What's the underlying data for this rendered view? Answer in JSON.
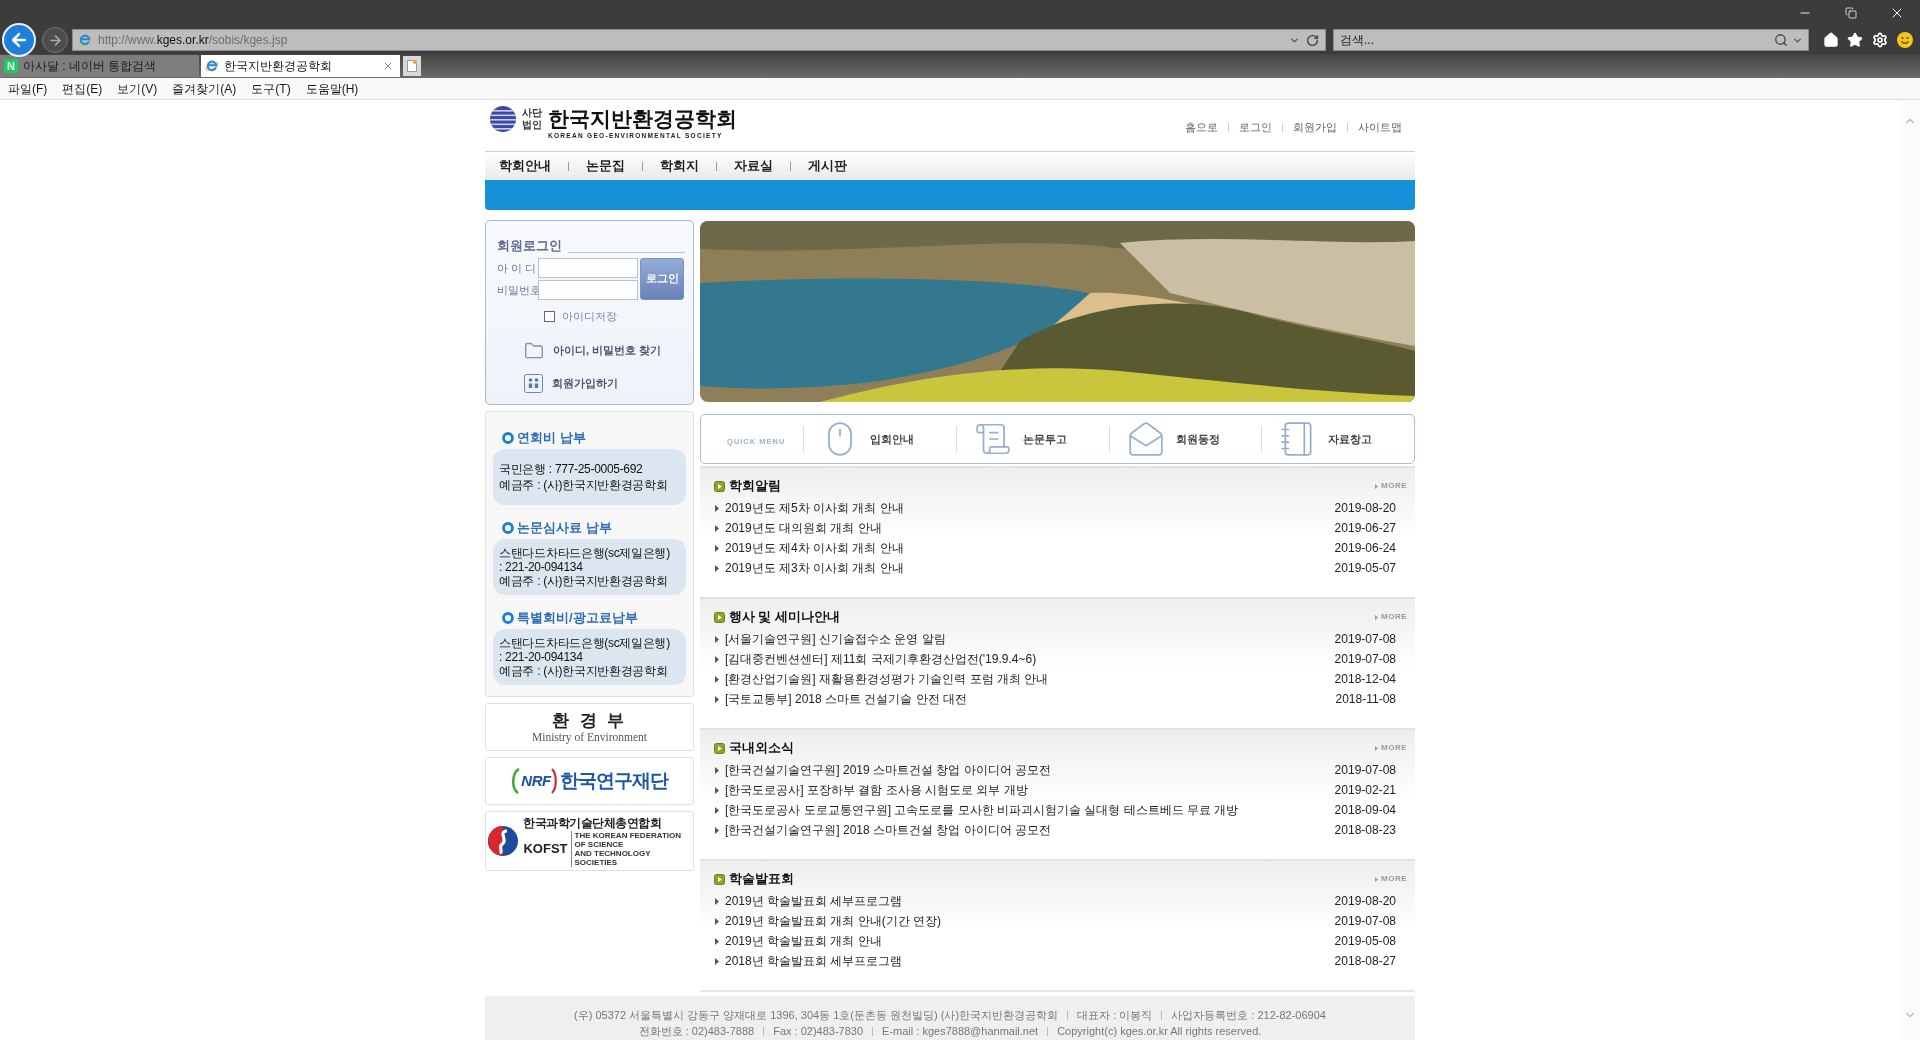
{
  "browser": {
    "address": "http://www.**kges.or.kr**/sobis/kges.jsp",
    "search_placeholder": "검색...",
    "tabs": [
      {
        "kind": "naver",
        "favicon_text": "N",
        "label": "아사달 : 네이버 통합검색",
        "selected": false
      },
      {
        "kind": "ie",
        "label": "한국지반환경공학회",
        "selected": true
      }
    ],
    "menu": [
      "파일(F)",
      "편집(E)",
      "보기(V)",
      "즐겨찾기(A)",
      "도구(T)",
      "도움말(H)"
    ]
  },
  "header": {
    "logo": {
      "badge": [
        "사단",
        "법인"
      ],
      "name": "한국지반환경공학회",
      "subtitle": "KOREAN GEO-ENVIRONMENTAL SOCIETY"
    },
    "top_links": [
      "홈으로",
      "로그인",
      "회원가입",
      "사이트맵"
    ],
    "nav": [
      "학회안내",
      "논문집",
      "학회지",
      "자료실",
      "게시판"
    ]
  },
  "login": {
    "title": "회원로그인",
    "fields": [
      {
        "label": "아 이 디"
      },
      {
        "label": "비밀번호"
      }
    ],
    "button": "로그인",
    "remember": {
      "label": "아이디저장",
      "checked": false
    },
    "links": [
      {
        "kind": "folder",
        "label": "아이디, 비밀번호 찾기"
      },
      {
        "kind": "people",
        "label": "회원가입하기"
      }
    ]
  },
  "payments": [
    {
      "title": "연회비 납부",
      "lines": [
        "국민은행 : 777-25-0005-692",
        "예금주 : (사)한국지반환경공학회"
      ]
    },
    {
      "title": "논문심사료 납부",
      "lines": [
        "스탠다드차타드은행(sc제일은행)",
        ": 221-20-094134",
        "예금주 : (사)한국지반환경공학회"
      ]
    },
    {
      "title": "특별회비/광고료납부",
      "lines": [
        "스탠다드차타드은행(sc제일은행)",
        ": 221-20-094134",
        "예금주 : (사)한국지반환경공학회"
      ]
    }
  ],
  "partners": [
    {
      "kind": "ministry",
      "title": "환 경 부",
      "subtitle": "Ministry of Environment"
    },
    {
      "kind": "nrf",
      "emblem_text": "NRF",
      "title": "한국연구재단"
    },
    {
      "kind": "kofst",
      "title": "한국과학기술단체총연합회",
      "abbr": "KOFST",
      "tagline": [
        "THE KOREAN FEDERATION OF SCIENCE",
        "AND TECHNOLOGY SOCIETIES"
      ]
    }
  ],
  "quick_menu": {
    "title": "QUICK MENU",
    "items": [
      {
        "kind": "mouse",
        "label": "입회안내"
      },
      {
        "kind": "paper",
        "label": "논문투고"
      },
      {
        "kind": "envelope",
        "label": "회원동정"
      },
      {
        "kind": "notebook",
        "label": "자료창고"
      }
    ]
  },
  "boards": [
    {
      "title": "학회알림",
      "more": "MORE",
      "posts": [
        {
          "title": "2019년도 제5차 이사회 개최 안내",
          "date": "2019-08-20"
        },
        {
          "title": "2019년도 대의원회 개최 안내",
          "date": "2019-06-27"
        },
        {
          "title": "2019년도 제4차 이사회 개최 안내",
          "date": "2019-06-24"
        },
        {
          "title": "2019년도 제3차 이사회 개최 안내",
          "date": "2019-05-07"
        }
      ]
    },
    {
      "title": "행사 및 세미나안내",
      "more": "MORE",
      "posts": [
        {
          "title": "[서울기술연구원] 신기술접수소 운영 알림",
          "date": "2019-07-08"
        },
        {
          "title": "[김대중컨벤션센터] 제11회 국제기후환경산업전('19.9.4~6)",
          "date": "2019-07-08"
        },
        {
          "title": "[환경산업기술원] 재활용환경성평가 기술인력 포럼 개최 안내",
          "date": "2018-12-04"
        },
        {
          "title": "[국토교통부] 2018 스마트 건설기술 안전 대전",
          "date": "2018-11-08"
        }
      ]
    },
    {
      "title": "국내외소식",
      "more": "MORE",
      "posts": [
        {
          "title": "[한국건설기술연구원] 2019 스마트건설 창업 아이디어 공모전",
          "date": "2019-07-08"
        },
        {
          "title": "[한국도로공사] 포장하부 결함 조사용 시험도로 외부 개방",
          "date": "2019-02-21"
        },
        {
          "title": "[한국도로공사 도로교통연구원] 고속도로를 모사한 비파괴시험기술 실대형 테스트베드 무료 개방",
          "date": "2018-09-04"
        },
        {
          "title": "[한국건설기술연구원] 2018 스마트건설 창업 아이디어 공모전",
          "date": "2018-08-23"
        }
      ]
    },
    {
      "title": "학술발표회",
      "more": "MORE",
      "posts": [
        {
          "title": "2019년 학술발표회 세부프로그램",
          "date": "2019-08-20"
        },
        {
          "title": "2019년 학술발표회 개최 안내(기간 연장)",
          "date": "2019-07-08"
        },
        {
          "title": "2019년 학술발표회 개최 안내",
          "date": "2019-05-08"
        },
        {
          "title": "2018년 학술발표회 세부프로그램",
          "date": "2018-08-27"
        }
      ]
    }
  ],
  "footer": {
    "lines": [
      [
        "(우) 05372 서울특별시 강동구 양재대로 1396, 304동 1호(둔촌동 원천빌딩) (사)한국지반환경공학회",
        "대표자 : 이봉직",
        "사업자등록번호 : 212-82-06904"
      ],
      [
        "전화번호 : 02)483-7888",
        "Fax : 02)483-7830",
        "E-mail : kges7888@hanmail.net",
        "Copyright(c) kges.or.kr All rights reserved."
      ]
    ]
  }
}
